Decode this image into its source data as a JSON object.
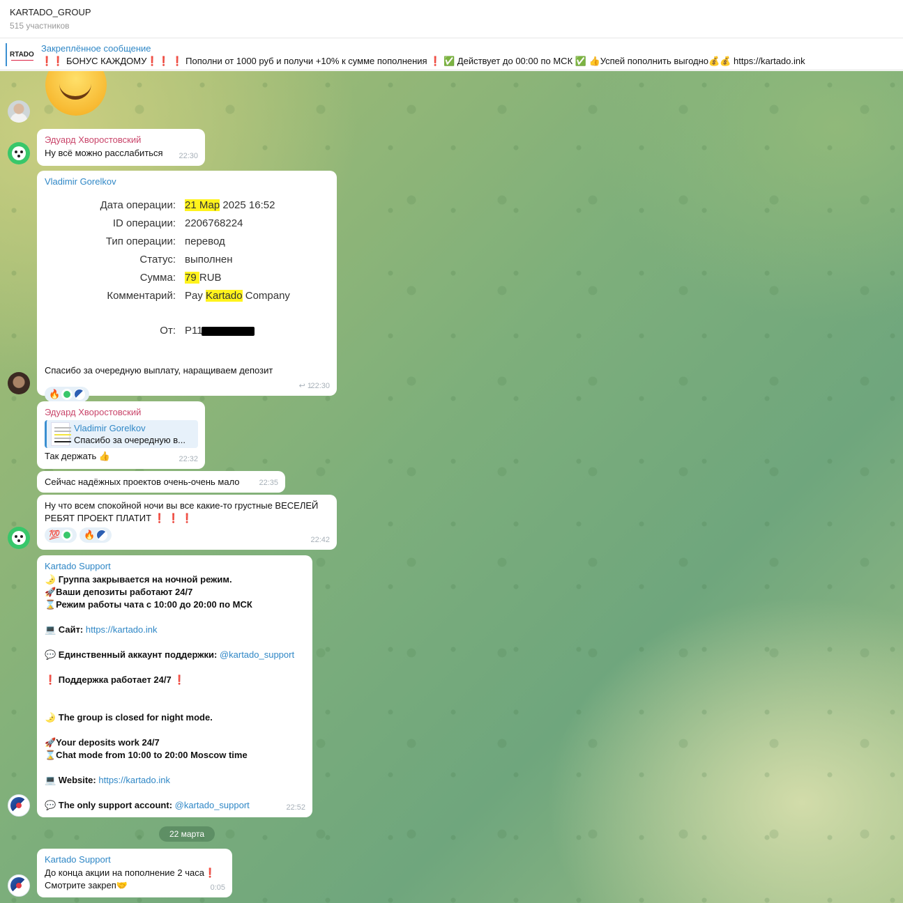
{
  "header": {
    "title": "KARTADO_GROUP",
    "subtitle": "515 участников"
  },
  "pinned": {
    "thumb_text": "RTADO",
    "title": "Закреплённое сообщение",
    "text": "❗❗ БОНУС КАЖДОМУ❗❗ ❗ Пополни от 1000 руб и получи +10% к сумме пополнения ❗ ✅ Действует до 00:00 по МСК ✅ 👍Успей пополнить выгодно💰💰 https://kartado.ink"
  },
  "messages": {
    "m1": {
      "sender": "Эдуард Хворостовский",
      "text": "Ну всё можно расслабиться",
      "time": "22:30"
    },
    "m2": {
      "sender": "Vladimir Gorelkov",
      "receipt": {
        "date_label": "Дата операции:",
        "date_hl": "21 Мар",
        "date_rest": " 2025 16:52",
        "id_label": "ID операции:",
        "id_value": "2206768224",
        "type_label": "Тип операции:",
        "type_value": "перевод",
        "status_label": "Статус:",
        "status_value": "выполнен",
        "sum_label": "Сумма:",
        "sum_hl": "79 ",
        "sum_rest": "RUB",
        "comment_label": "Комментарий:",
        "comment_pre": "Pay ",
        "comment_hl": "Kartado",
        "comment_post": " Company",
        "from_label": "От:",
        "from_value": "P11"
      },
      "text": "Спасибо за очередную выплату, наращиваем депозит",
      "reaction_emoji": "🔥",
      "forwards": "1",
      "time": "22:30"
    },
    "m3": {
      "sender": "Эдуард Хворостовский",
      "reply_name": "Vladimir Gorelkov",
      "reply_text": "Спасибо за очередную в...",
      "text": "Так держать 👍",
      "time": "22:32"
    },
    "m4": {
      "text": "Сейчас надёжных проектов очень-очень мало",
      "time": "22:35"
    },
    "m5": {
      "line1": "Ну что всем спокойной ночи вы все какие-то грустные ВЕСЕЛЕЙ",
      "line2": "РЕБЯТ ПРОЕКТ ПЛАТИТ ❗ ❗ ❗",
      "reaction1": "💯",
      "reaction2": "🔥",
      "time": "22:42"
    },
    "m6": {
      "sender": "Kartado Support",
      "l1": "🌛 Группа закрывается на ночной режим.",
      "l2": "🚀Ваши депозиты работают 24/7",
      "l3": "⌛Режим работы чата с 10:00 до 20:00 по МСК",
      "site_label": "💻 Сайт: ",
      "site_link": "https://kartado.ink",
      "support_label": "💬 Единственный аккаунт поддержки: ",
      "support_link": "@kartado_support",
      "l_support": "❗ Поддержка работает 24/7 ❗",
      "e1": "🌛 The group is closed for night mode.",
      "e2": "🚀Your deposits work 24/7",
      "e3": "⌛Chat mode from 10:00 to 20:00 Moscow time",
      "web_label": "💻 Website: ",
      "web_link": "https://kartado.ink",
      "only_label": "💬 The only support account: ",
      "only_link": "@kartado_support",
      "time": "22:52"
    },
    "date_separator": "22 марта",
    "m7": {
      "sender": "Kartado Support",
      "line1": "До конца акции на пополнение 2 часа❗",
      "line2": "Смотрите закреп🤝",
      "time": "0:05"
    }
  }
}
